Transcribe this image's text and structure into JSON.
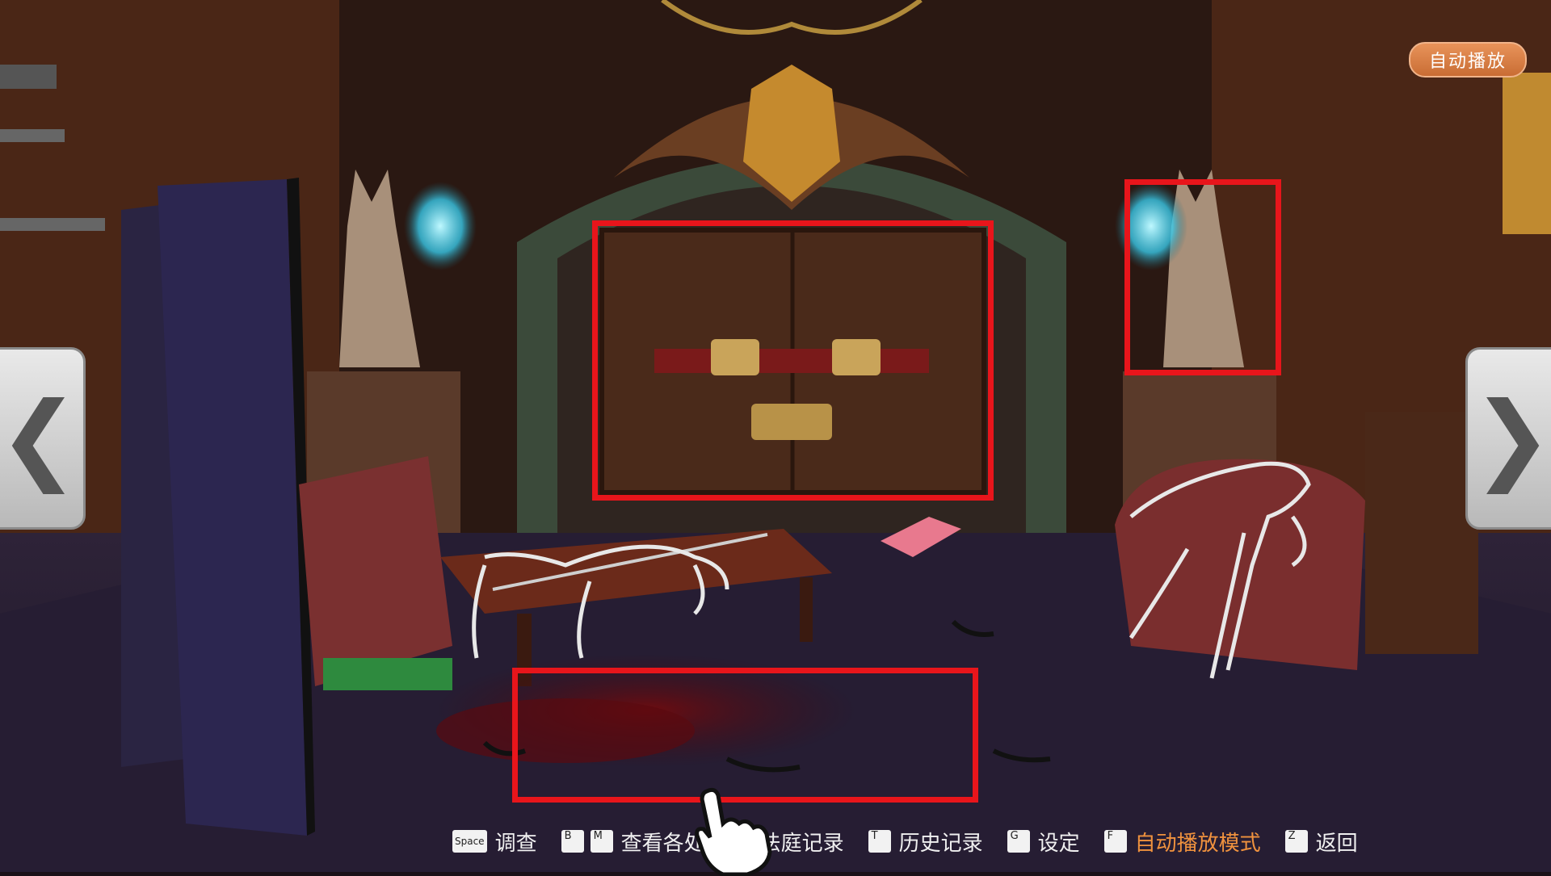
{
  "top_right": {
    "autoplay_label": "自动播放"
  },
  "nav": {
    "left_glyph": "❮",
    "right_glyph": "❯"
  },
  "controls": [
    {
      "keys": [
        "Space"
      ],
      "label": "调查"
    },
    {
      "keys": [
        "B",
        "M"
      ],
      "label": "查看各处"
    },
    {
      "keys": [
        "E"
      ],
      "label": "法庭记录"
    },
    {
      "keys": [
        "T"
      ],
      "label": "历史记录"
    },
    {
      "keys": [
        "G"
      ],
      "label": "设定"
    },
    {
      "keys": [
        "F"
      ],
      "label": "自动播放模式",
      "active": true
    },
    {
      "keys": [
        "Z"
      ],
      "label": "返回"
    }
  ],
  "colors": {
    "highlight": "#e8151b",
    "accent": "#f0923e",
    "autoplay_bg": "#d97d43"
  },
  "icons": [
    "chevron-left-icon",
    "chevron-right-icon",
    "hand-cursor-icon"
  ]
}
